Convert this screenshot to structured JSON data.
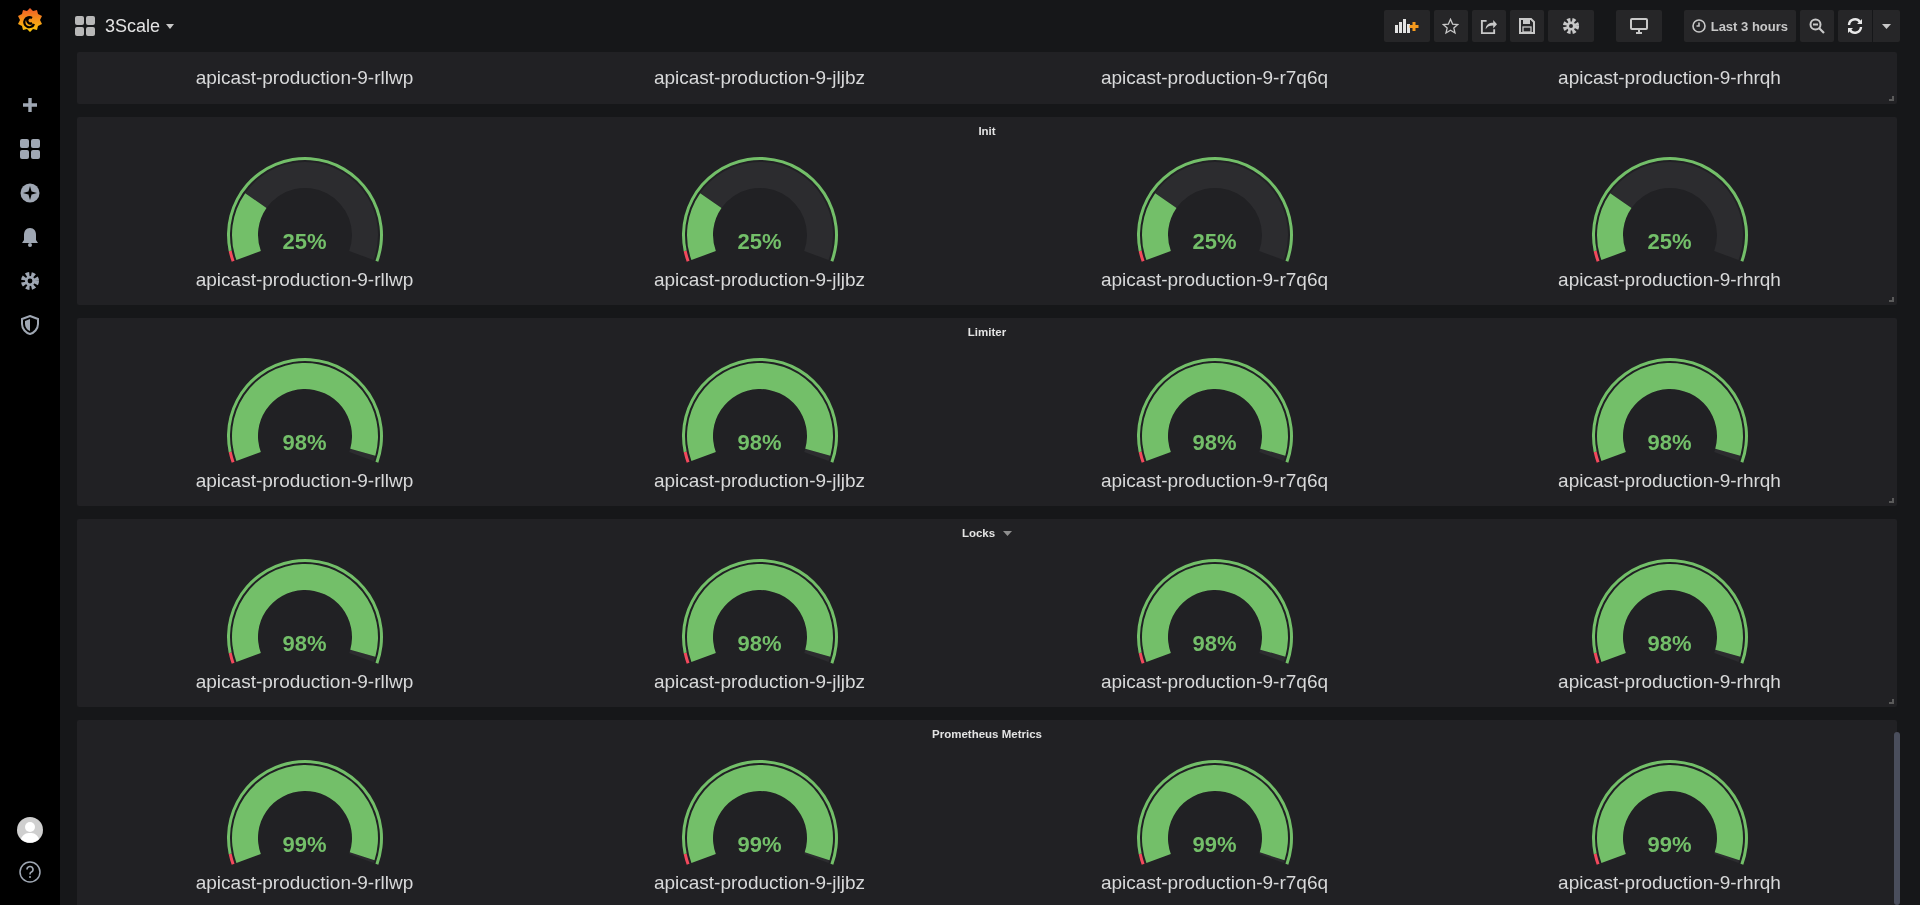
{
  "topbar": {
    "dashboard_title": "3Scale",
    "time_range": "Last 3 hours"
  },
  "panels": [
    {
      "menu_caret": false,
      "gauges": [
        {
          "name": "apicast-production-9-rllwp"
        },
        {
          "name": "apicast-production-9-jljbz"
        },
        {
          "name": "apicast-production-9-r7q6q"
        },
        {
          "name": "apicast-production-9-rhrqh"
        }
      ]
    },
    {
      "title": "Init",
      "menu_caret": false,
      "gauges": [
        {
          "name": "apicast-production-9-rllwp",
          "value": "25%",
          "level": 0.25
        },
        {
          "name": "apicast-production-9-jljbz",
          "value": "25%",
          "level": 0.25
        },
        {
          "name": "apicast-production-9-r7q6q",
          "value": "25%",
          "level": 0.25
        },
        {
          "name": "apicast-production-9-rhrqh",
          "value": "25%",
          "level": 0.25
        }
      ]
    },
    {
      "title": "Limiter",
      "menu_caret": false,
      "gauges": [
        {
          "name": "apicast-production-9-rllwp",
          "value": "98%",
          "level": 0.98
        },
        {
          "name": "apicast-production-9-jljbz",
          "value": "98%",
          "level": 0.98
        },
        {
          "name": "apicast-production-9-r7q6q",
          "value": "98%",
          "level": 0.98
        },
        {
          "name": "apicast-production-9-rhrqh",
          "value": "98%",
          "level": 0.98
        }
      ]
    },
    {
      "title": "Locks",
      "menu_caret": true,
      "gauges": [
        {
          "name": "apicast-production-9-rllwp",
          "value": "98%",
          "level": 0.98
        },
        {
          "name": "apicast-production-9-jljbz",
          "value": "98%",
          "level": 0.98
        },
        {
          "name": "apicast-production-9-r7q6q",
          "value": "98%",
          "level": 0.98
        },
        {
          "name": "apicast-production-9-rhrqh",
          "value": "98%",
          "level": 0.98
        }
      ]
    },
    {
      "title": "Prometheus Metrics",
      "menu_caret": false,
      "gauges": [
        {
          "name": "apicast-production-9-rllwp",
          "value": "99%",
          "level": 0.99
        },
        {
          "name": "apicast-production-9-jljbz",
          "value": "99%",
          "level": 0.99
        },
        {
          "name": "apicast-production-9-r7q6q",
          "value": "99%",
          "level": 0.99
        },
        {
          "name": "apicast-production-9-rhrqh",
          "value": "99%",
          "level": 0.99
        }
      ]
    }
  ]
}
